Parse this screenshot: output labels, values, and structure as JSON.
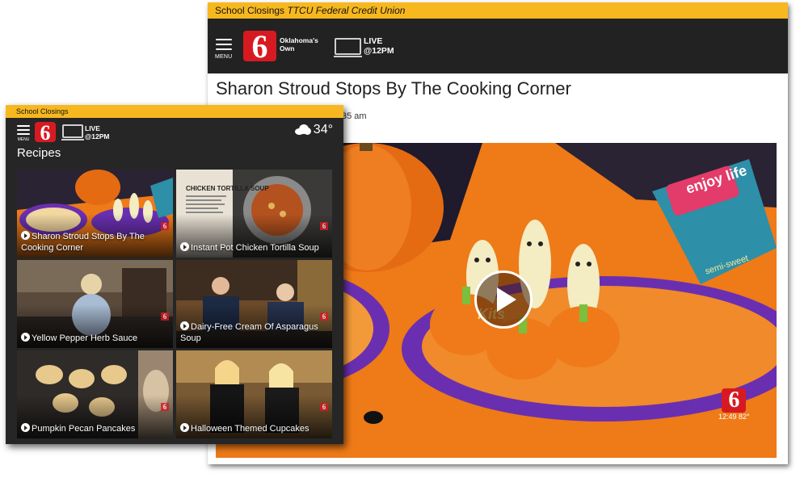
{
  "big_window": {
    "alert": {
      "label": "School Closings",
      "detail": "TTCU Federal Credit Union"
    },
    "menu_label": "MENU",
    "logo_text": "6",
    "tagline": "Oklahoma's Own",
    "live_label": "LIVE",
    "live_time": "@12PM",
    "article_title": "Sharon Stroud Stops By The Cooking Corner",
    "timestamp_fragment": "35 am",
    "video": {
      "bug_logo": "6",
      "bug_time": "12:49",
      "bug_temp": "82°",
      "package_text": "enjoy life",
      "package_sub": "semi-sweet",
      "plate_text": "Kits"
    }
  },
  "small_window": {
    "alert_label": "School Closings",
    "menu_label": "MENU",
    "logo_text": "6",
    "live_label": "LIVE",
    "live_time": "@12PM",
    "weather": {
      "temp": "34°",
      "icon": "rain-cloud-icon"
    },
    "heading": "Recipes",
    "cards": [
      {
        "caption": "Sharon Stroud Stops By The Cooking Corner"
      },
      {
        "caption": "Instant Pot Chicken Tortilla Soup",
        "thumb_title": "CHICKEN TORTILLA SOUP"
      },
      {
        "caption": "Yellow Pepper Herb Sauce"
      },
      {
        "caption": "Dairy-Free Cream Of Asparagus Soup"
      },
      {
        "caption": "Pumpkin Pecan Pancakes"
      },
      {
        "caption": "Halloween Themed Cupcakes"
      }
    ]
  },
  "colors": {
    "alert": "#f7b81f",
    "header": "#222222",
    "brand_red": "#d71a21",
    "table_orange": "#ee7a18"
  }
}
